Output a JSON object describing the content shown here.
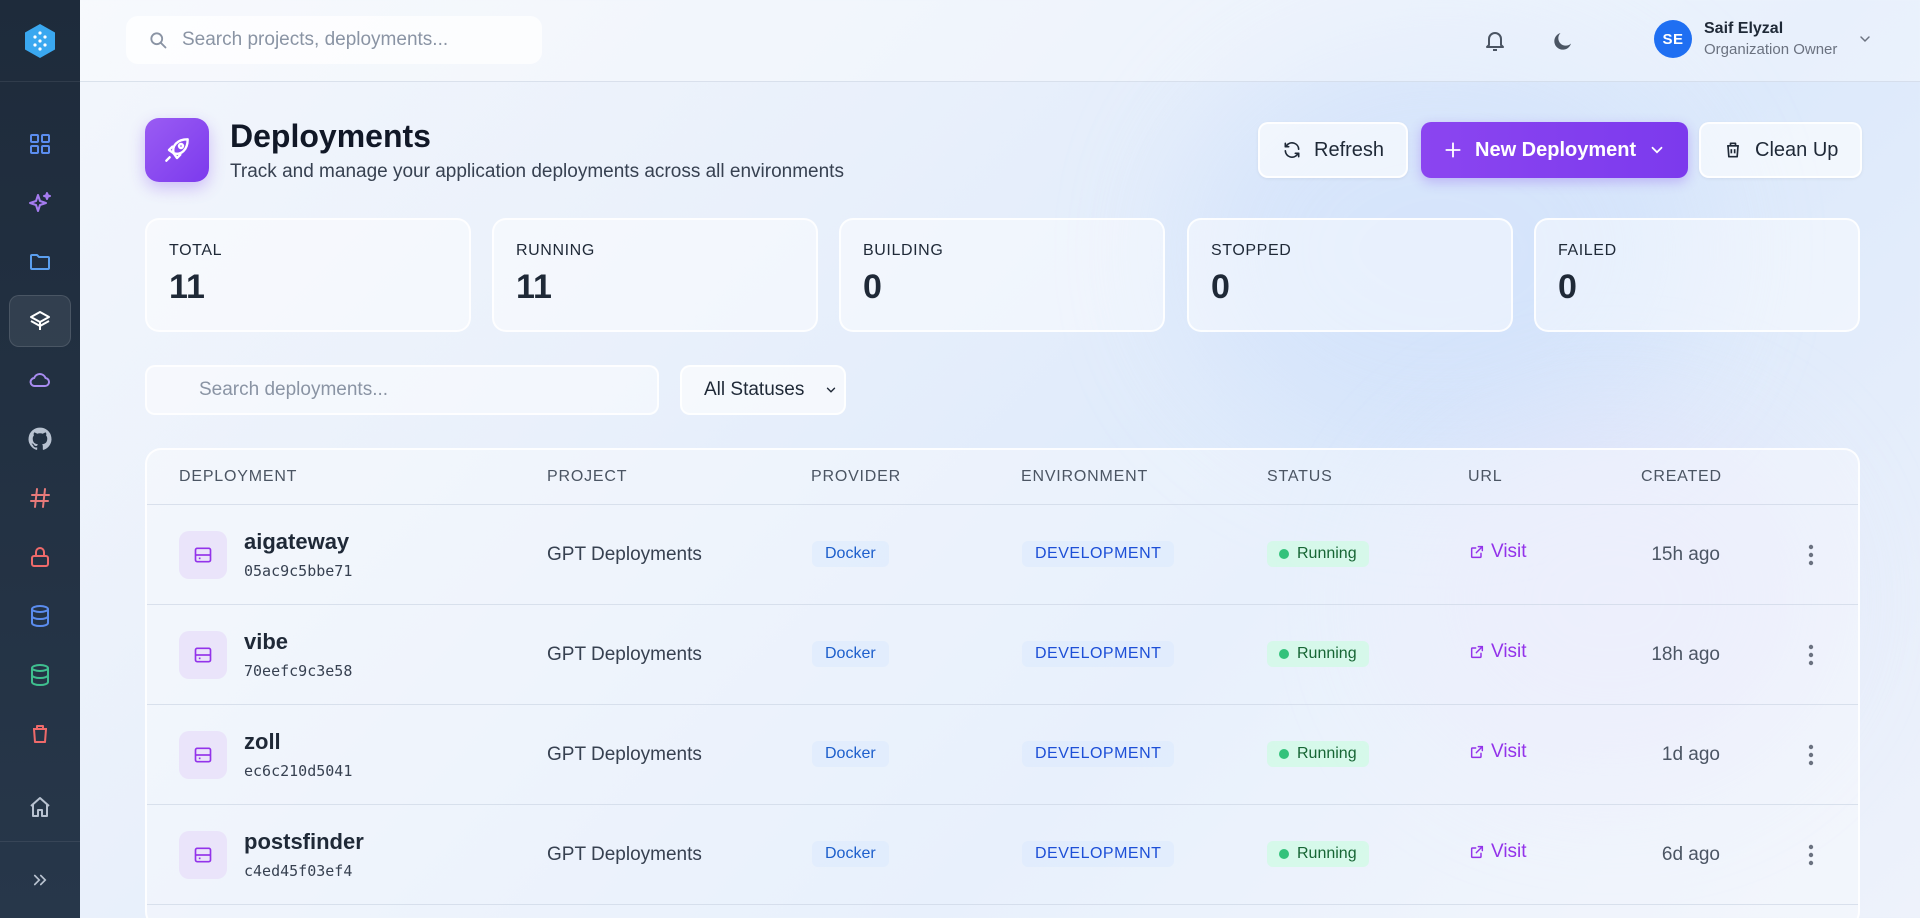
{
  "search": {
    "placeholder": "Search projects, deployments..."
  },
  "user": {
    "initials": "SE",
    "name": "Saif Elyzal",
    "role": "Organization Owner"
  },
  "sidebar": {
    "items": [
      {
        "icon": "grid-icon",
        "color": "#5b8def"
      },
      {
        "icon": "sparkles-icon",
        "color": "#a57cf0"
      },
      {
        "icon": "folder-icon",
        "color": "#5b9fef"
      },
      {
        "icon": "layers-icon",
        "color": "#ffffff",
        "active": true
      },
      {
        "icon": "cloud-icon",
        "color": "#a88cf0"
      },
      {
        "icon": "github-icon",
        "color": "#b8c2d0"
      },
      {
        "icon": "hash-icon",
        "color": "#e77a7a"
      },
      {
        "icon": "lock-icon",
        "color": "#ef6a6a"
      },
      {
        "icon": "database-icon",
        "color": "#5b8def"
      },
      {
        "icon": "database-icon",
        "color": "#3fbf8f"
      },
      {
        "icon": "trash-icon",
        "color": "#ef6a6a"
      }
    ]
  },
  "header": {
    "title": "Deployments",
    "subtitle": "Track and manage your application deployments across all environments",
    "refresh_label": "Refresh",
    "new_label": "New Deployment",
    "cleanup_label": "Clean Up"
  },
  "stats": [
    {
      "label": "TOTAL",
      "value": "11"
    },
    {
      "label": "RUNNING",
      "value": "11"
    },
    {
      "label": "BUILDING",
      "value": "0"
    },
    {
      "label": "STOPPED",
      "value": "0"
    },
    {
      "label": "FAILED",
      "value": "0"
    }
  ],
  "filters": {
    "search_placeholder": "Search deployments...",
    "status_value": "All Statuses"
  },
  "table": {
    "headers": [
      "DEPLOYMENT",
      "PROJECT",
      "PROVIDER",
      "ENVIRONMENT",
      "STATUS",
      "URL",
      "CREATED"
    ],
    "visit_label": "Visit",
    "rows": [
      {
        "name": "aigateway",
        "id": "05ac9c5bbe71",
        "project": "GPT Deployments",
        "provider": "Docker",
        "environment": "DEVELOPMENT",
        "status": "Running",
        "created": "15h ago"
      },
      {
        "name": "vibe",
        "id": "70eefc9c3e58",
        "project": "GPT Deployments",
        "provider": "Docker",
        "environment": "DEVELOPMENT",
        "status": "Running",
        "created": "18h ago"
      },
      {
        "name": "zoll",
        "id": "ec6c210d5041",
        "project": "GPT Deployments",
        "provider": "Docker",
        "environment": "DEVELOPMENT",
        "status": "Running",
        "created": "1d ago"
      },
      {
        "name": "postsfinder",
        "id": "c4ed45f03ef4",
        "project": "GPT Deployments",
        "provider": "Docker",
        "environment": "DEVELOPMENT",
        "status": "Running",
        "created": "6d ago"
      }
    ]
  },
  "colors": {
    "accent": "#7c3aed",
    "avatar": "#1f6ff2",
    "running": "#34c27b",
    "link": "#9333ea"
  }
}
